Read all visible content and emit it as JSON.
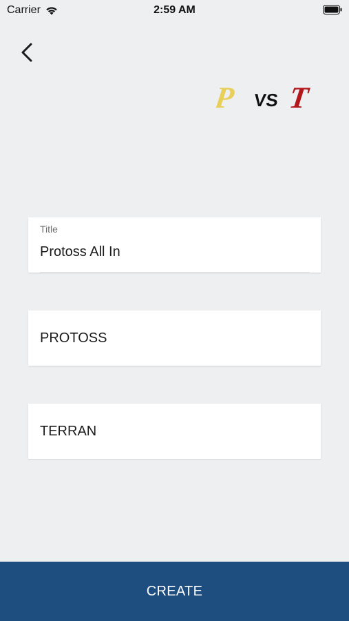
{
  "status_bar": {
    "carrier": "Carrier",
    "time": "2:59 AM"
  },
  "logo": {
    "left": "P",
    "vs": "VS",
    "right": "T",
    "left_color": "#e8cf5a",
    "vs_color": "#111111",
    "right_color": "#b3161b"
  },
  "form": {
    "title_label": "Title",
    "title_value": "Protoss All In",
    "race_one": "PROTOSS",
    "race_two": "TERRAN"
  },
  "create_label": "CREATE",
  "colors": {
    "background": "#eeeff1",
    "button": "#1e4d7f"
  },
  "icons": [
    "wifi-icon",
    "battery-icon",
    "back-chevron-icon"
  ]
}
